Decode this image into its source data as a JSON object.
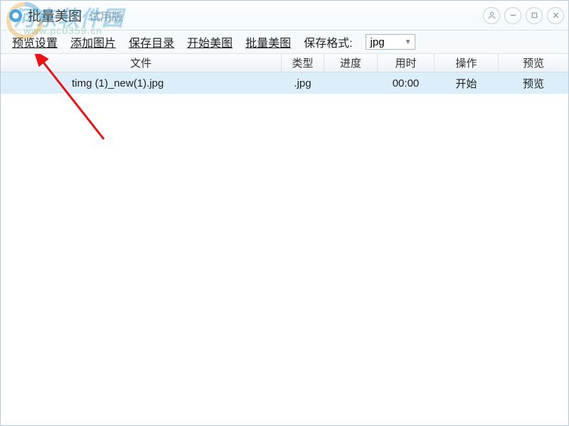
{
  "titlebar": {
    "app_title": "批量美图",
    "app_sub": "试用版"
  },
  "toolbar": {
    "preview_settings": "预览设置",
    "add_images": "添加图片",
    "save_dir": "保存目录",
    "start_beautify": "开始美图",
    "batch_beautify": "批量美图",
    "save_format_label": "保存格式:",
    "save_format_value": "jpg"
  },
  "columns": {
    "file": "文件",
    "type": "类型",
    "progress": "进度",
    "time": "用时",
    "operate": "操作",
    "preview": "预览"
  },
  "rows": [
    {
      "file": "timg (1)_new(1).jpg",
      "type": ".jpg",
      "progress": "",
      "time": "00:00",
      "operate": "开始",
      "preview": "预览",
      "selected": true
    }
  ],
  "watermark": {
    "text": "河东软件园",
    "url": "www.pc0359.cn"
  }
}
